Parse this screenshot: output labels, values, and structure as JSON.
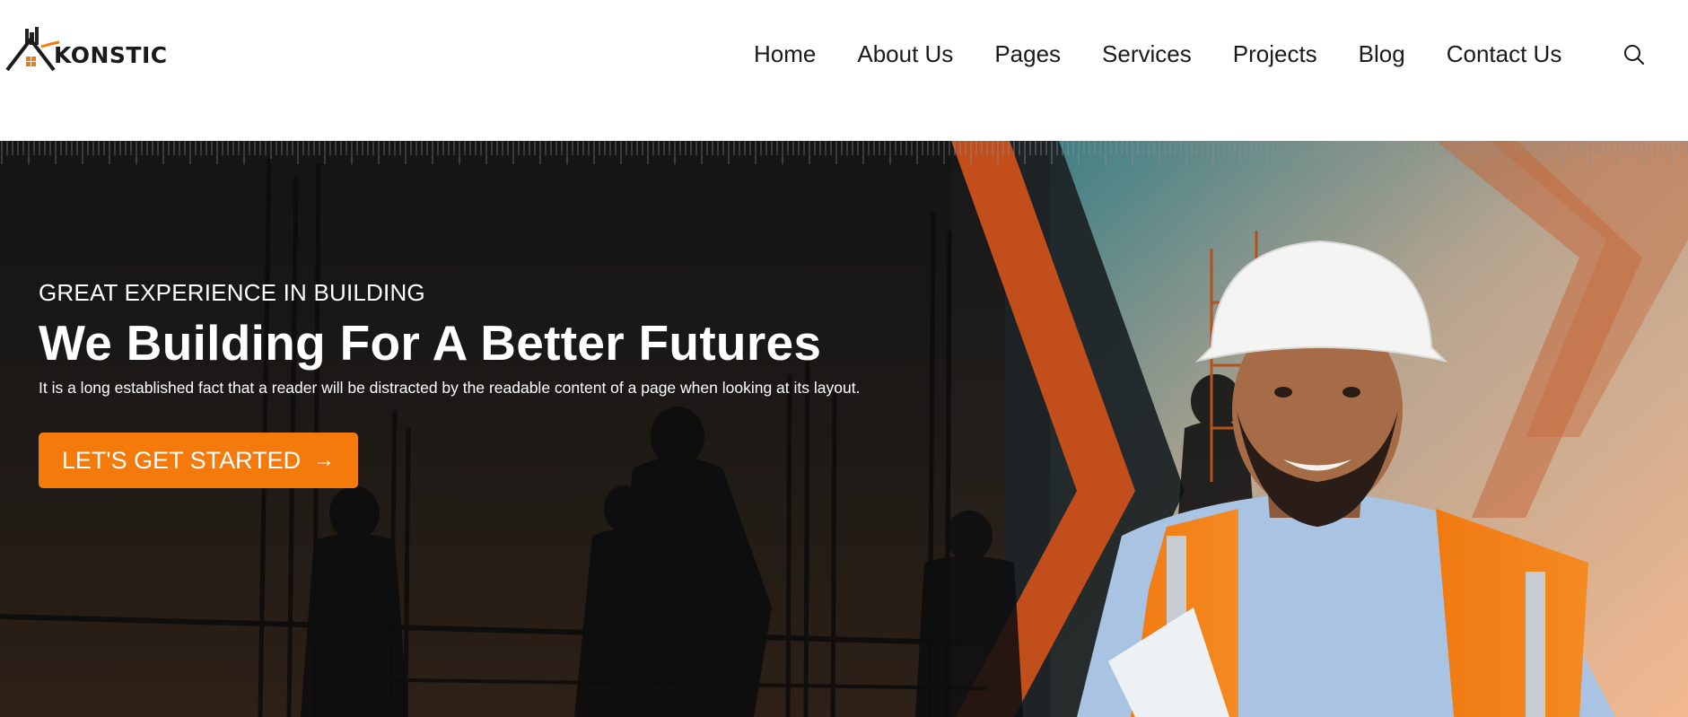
{
  "brand": {
    "name": "KONSTIC",
    "accent_color": "#f47a0c",
    "logo_icon": "house-logo-icon"
  },
  "nav": {
    "items": [
      {
        "label": "Home"
      },
      {
        "label": "About Us"
      },
      {
        "label": "Pages"
      },
      {
        "label": "Services"
      },
      {
        "label": "Projects"
      },
      {
        "label": "Blog"
      },
      {
        "label": "Contact Us"
      }
    ],
    "search_icon": "search-icon"
  },
  "hero": {
    "eyebrow": "GREAT EXPERIENCE IN BUILDING",
    "headline": "We Building For A Better Futures",
    "subtext": "It is a long established fact that a reader will be distracted by the readable content of a page when looking at its layout.",
    "cta_label": "LET'S GET STARTED",
    "cta_arrow": "→"
  }
}
